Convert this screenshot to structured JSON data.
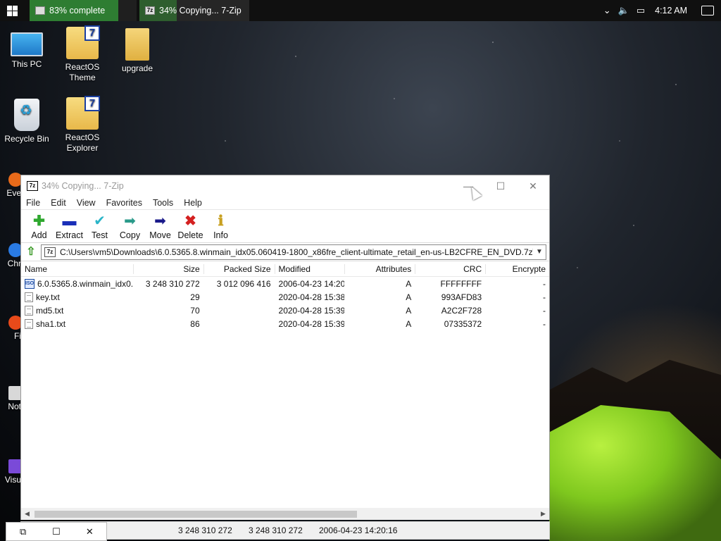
{
  "taskbar": {
    "task1_label": "83% complete",
    "task1_progress": 0.83,
    "task2_label": "34% Copying... 7-Zip",
    "task2_progress": 0.34,
    "clock": "4:12 AM"
  },
  "desktop": {
    "icons": [
      {
        "label": "This PC"
      },
      {
        "label": "ReactOS Theme"
      },
      {
        "label": "upgrade"
      },
      {
        "label": "Recycle Bin"
      },
      {
        "label": "ReactOS Explorer"
      }
    ],
    "partial_labels": [
      "Eve",
      "Chr",
      "Fi",
      "Not",
      "Visu"
    ]
  },
  "window": {
    "title": "34% Copying... 7-Zip",
    "app_icon_text": "7z",
    "menu": [
      "File",
      "Edit",
      "View",
      "Favorites",
      "Tools",
      "Help"
    ],
    "toolbar": [
      {
        "label": "Add",
        "icon": "plus-icon",
        "color": "#2fa82f"
      },
      {
        "label": "Extract",
        "icon": "minus-icon",
        "color": "#1a2fb8"
      },
      {
        "label": "Test",
        "icon": "check-icon",
        "color": "#2bb5c8"
      },
      {
        "label": "Copy",
        "icon": "arrow-right-icon",
        "color": "#2a9a8a"
      },
      {
        "label": "Move",
        "icon": "arrow-right-icon",
        "color": "#1a1a8a"
      },
      {
        "label": "Delete",
        "icon": "x-icon",
        "color": "#d42020"
      },
      {
        "label": "Info",
        "icon": "info-icon",
        "color": "#c8a020"
      }
    ],
    "path": "C:\\Users\\vm5\\Downloads\\6.0.5365.8.winmain_idx05.060419-1800_x86fre_client-ultimate_retail_en-us-LB2CFRE_EN_DVD.7z\\",
    "columns": [
      "Name",
      "Size",
      "Packed Size",
      "Modified",
      "Attributes",
      "CRC",
      "Encrypte"
    ],
    "files": [
      {
        "name": "6.0.5365.8.winmain_idx0...",
        "size": "3 248 310 272",
        "packed": "3 012 096 416",
        "modified": "2006-04-23 14:20",
        "attributes": "A",
        "crc": "FFFFFFFF",
        "encrypted": "-",
        "type": "archive"
      },
      {
        "name": "key.txt",
        "size": "29",
        "packed": "",
        "modified": "2020-04-28 15:38",
        "attributes": "A",
        "crc": "993AFD83",
        "encrypted": "-",
        "type": "text"
      },
      {
        "name": "md5.txt",
        "size": "70",
        "packed": "",
        "modified": "2020-04-28 15:39",
        "attributes": "A",
        "crc": "A2C2F728",
        "encrypted": "-",
        "type": "text"
      },
      {
        "name": "sha1.txt",
        "size": "86",
        "packed": "",
        "modified": "2020-04-28 15:39",
        "attributes": "A",
        "crc": "07335372",
        "encrypted": "-",
        "type": "text"
      }
    ],
    "status": {
      "size": "3 248 310 272",
      "packed": "3 248 310 272",
      "modified": "2006-04-23 14:20:16"
    }
  }
}
